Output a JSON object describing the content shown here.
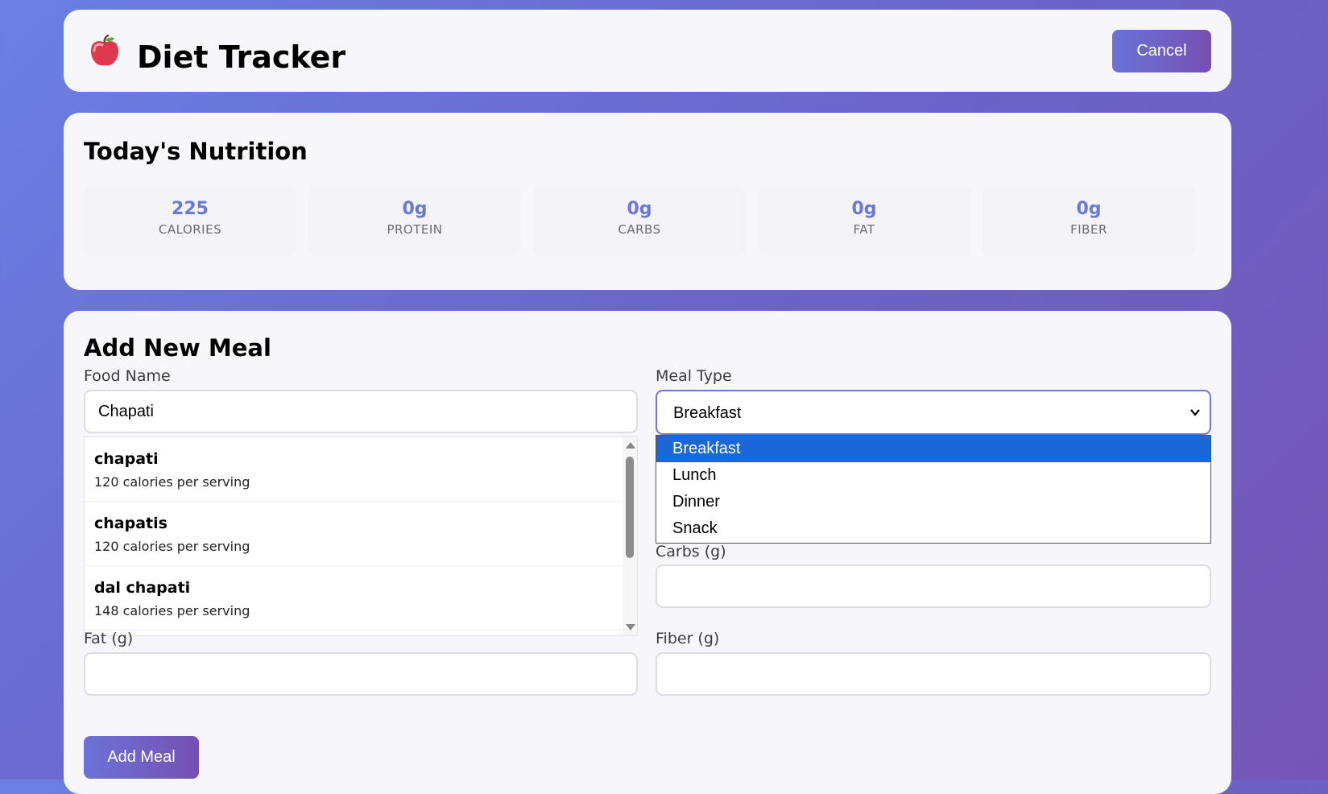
{
  "header": {
    "logo_icon": "apple-icon",
    "title": "Diet Tracker",
    "cancel_label": "Cancel"
  },
  "nutrition": {
    "title": "Today's Nutrition",
    "stats": [
      {
        "value": "225",
        "label": "CALORIES"
      },
      {
        "value": "0g",
        "label": "PROTEIN"
      },
      {
        "value": "0g",
        "label": "CARBS"
      },
      {
        "value": "0g",
        "label": "FAT"
      },
      {
        "value": "0g",
        "label": "FIBER"
      }
    ]
  },
  "meal_form": {
    "title": "Add New Meal",
    "food_name": {
      "label": "Food Name",
      "value": "Chapati"
    },
    "meal_type": {
      "label": "Meal Type",
      "selected": "Breakfast",
      "options": [
        "Breakfast",
        "Lunch",
        "Dinner",
        "Snack"
      ]
    },
    "carbs": {
      "label": "Carbs (g)",
      "value": ""
    },
    "fat": {
      "label": "Fat (g)",
      "value": ""
    },
    "fiber": {
      "label": "Fiber (g)",
      "value": ""
    },
    "suggestions": [
      {
        "name": "chapati",
        "calories": "120 calories per serving"
      },
      {
        "name": "chapatis",
        "calories": "120 calories per serving"
      },
      {
        "name": "dal chapati",
        "calories": "148 calories per serving"
      }
    ],
    "add_label": "Add Meal"
  },
  "colors": {
    "accent": "#6a78d8",
    "selected_option": "#1a68d8"
  }
}
